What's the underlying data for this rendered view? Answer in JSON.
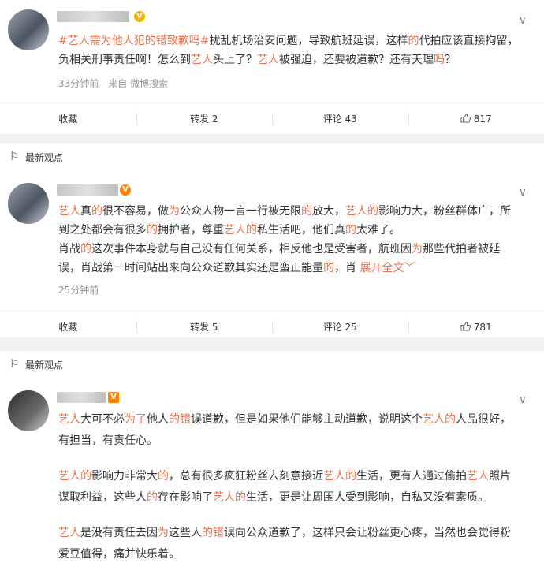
{
  "post1": {
    "body_parts": [
      {
        "t": "#艺人需为他人犯的错致歉吗#",
        "c": "link"
      },
      {
        "t": "扰乱机场治安问题，导致航班延误，这样",
        "c": ""
      },
      {
        "t": "的",
        "c": "red"
      },
      {
        "t": "代拍应该直接拘留，负相关刑事责任啊！怎么到",
        "c": ""
      },
      {
        "t": "艺人",
        "c": "red"
      },
      {
        "t": "头上了？",
        "c": ""
      },
      {
        "t": "艺人",
        "c": "red"
      },
      {
        "t": "被强迫，还要被道歉？还有天理",
        "c": ""
      },
      {
        "t": "吗",
        "c": "red"
      },
      {
        "t": "？",
        "c": ""
      }
    ],
    "meta": "33分钟前　来自 微博搜索",
    "actions": {
      "collect": "收藏",
      "repost": "转发 2",
      "comment": "评论 43",
      "like": "817"
    }
  },
  "section1": {
    "label": "最新观点"
  },
  "post2": {
    "body_parts": [
      {
        "t": "艺人",
        "c": "red"
      },
      {
        "t": "真",
        "c": ""
      },
      {
        "t": "的",
        "c": "red"
      },
      {
        "t": "很不容易，做",
        "c": ""
      },
      {
        "t": "为",
        "c": "red"
      },
      {
        "t": "公众人物一言一行被无限",
        "c": ""
      },
      {
        "t": "的",
        "c": "red"
      },
      {
        "t": "放大，",
        "c": ""
      },
      {
        "t": "艺人的",
        "c": "red"
      },
      {
        "t": "影响力大，粉丝群体广，所到之处都会有很多",
        "c": ""
      },
      {
        "t": "的",
        "c": "red"
      },
      {
        "t": "拥护者，尊重",
        "c": ""
      },
      {
        "t": "艺人的",
        "c": "red"
      },
      {
        "t": "私生活吧，他们真",
        "c": ""
      },
      {
        "t": "的",
        "c": "red"
      },
      {
        "t": "太难了。",
        "c": ""
      },
      {
        "t": "\n肖战",
        "c": ""
      },
      {
        "t": "的",
        "c": "red"
      },
      {
        "t": "这次事件本身就与自己没有任何关系，相反他也是受害者，航班因",
        "c": ""
      },
      {
        "t": "为",
        "c": "red"
      },
      {
        "t": "那些代拍者被延误，肖战第一时间站出来向公众道歉其实还是蛮正能量",
        "c": ""
      },
      {
        "t": "的",
        "c": "red"
      },
      {
        "t": "，肖 ",
        "c": ""
      },
      {
        "t": "展开全文﹀",
        "c": "expand"
      }
    ],
    "meta": "25分钟前",
    "actions": {
      "collect": "收藏",
      "repost": "转发 5",
      "comment": "评论 25",
      "like": "781"
    }
  },
  "section2": {
    "label": "最新观点"
  },
  "post3": {
    "paragraphs": [
      [
        {
          "t": "艺人",
          "c": "red"
        },
        {
          "t": "大可不必",
          "c": ""
        },
        {
          "t": "为了",
          "c": "red"
        },
        {
          "t": "他人",
          "c": ""
        },
        {
          "t": "的错",
          "c": "red"
        },
        {
          "t": "误道歉，但是如果他们能够主动道歉，说明这个",
          "c": ""
        },
        {
          "t": "艺人的",
          "c": "red"
        },
        {
          "t": "人品很好，有担当，有责任心。",
          "c": ""
        }
      ],
      [
        {
          "t": "艺人的",
          "c": "red"
        },
        {
          "t": "影响力非常大",
          "c": ""
        },
        {
          "t": "的",
          "c": "red"
        },
        {
          "t": "，总有很多疯狂粉丝去刻意接近",
          "c": ""
        },
        {
          "t": "艺人的",
          "c": "red"
        },
        {
          "t": "生活，更有人通过偷拍",
          "c": ""
        },
        {
          "t": "艺人",
          "c": "red"
        },
        {
          "t": "照片谋取利益，这些人",
          "c": ""
        },
        {
          "t": "的",
          "c": "red"
        },
        {
          "t": "存在影响了",
          "c": ""
        },
        {
          "t": "艺人的",
          "c": "red"
        },
        {
          "t": "生活，更是让周围人受到影响，自私又没有素质。",
          "c": ""
        }
      ],
      [
        {
          "t": "艺人",
          "c": "red"
        },
        {
          "t": "是没有责任去因",
          "c": ""
        },
        {
          "t": "为",
          "c": "red"
        },
        {
          "t": "这些人",
          "c": ""
        },
        {
          "t": "的错",
          "c": "red"
        },
        {
          "t": "误向公众道歉了，这样只会让粉丝更心疼，当然也会觉得粉爱豆值得，痛并快乐着。",
          "c": ""
        }
      ]
    ]
  },
  "icons": {
    "more": "chevron-down-icon",
    "like": "thumb-up-icon",
    "section": "flag-icon"
  },
  "colors": {
    "accent": "#eb7350",
    "meta": "#939393",
    "badge_gold": "#f3b400",
    "badge_orange": "#ff8200"
  }
}
